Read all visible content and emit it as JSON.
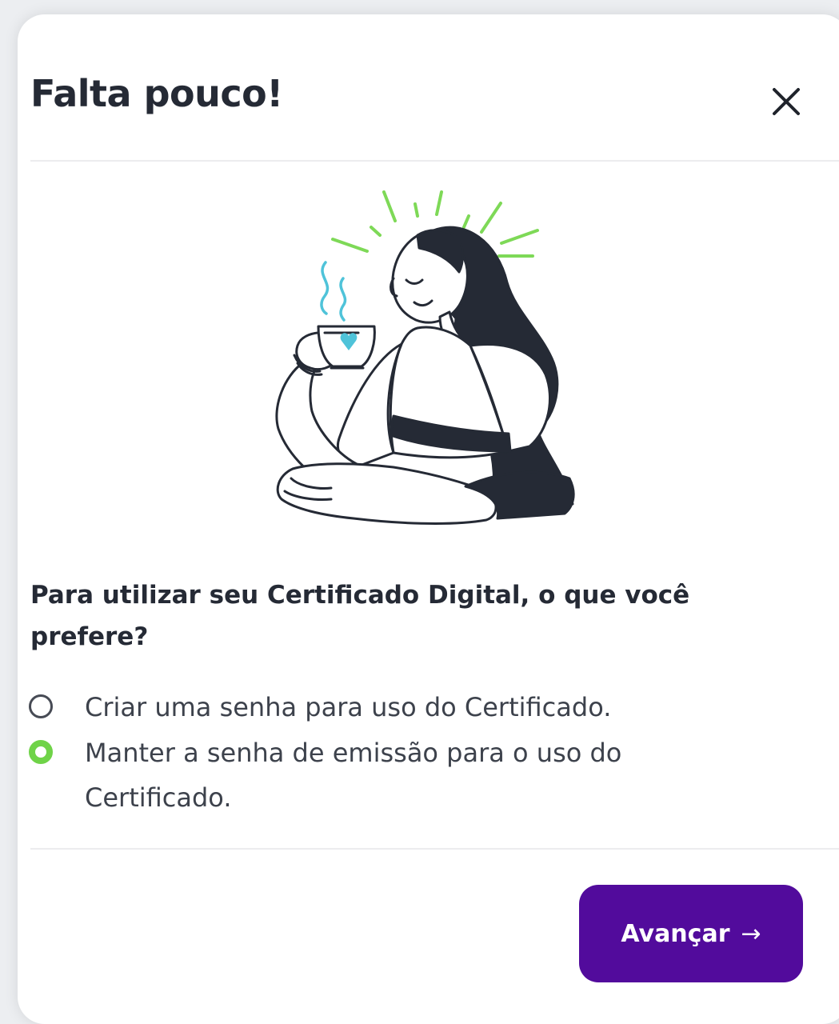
{
  "modal": {
    "title": "Falta pouco!",
    "close_icon": "close-icon",
    "question": "Para utilizar seu Certificado Digital, o que você prefere?",
    "options": [
      {
        "label": "Criar uma senha para uso do Certificado.",
        "selected": false
      },
      {
        "label": "Manter a senha de emissão para o uso do Certificado.",
        "selected": true
      }
    ],
    "next_button": {
      "label": "Avançar",
      "icon": "arrow-right-icon",
      "arrow": "→"
    },
    "illustration_icon": "woman-drinking-coffee-illustration"
  },
  "colors": {
    "primary": "#520b9c",
    "accent_green": "#6fd348",
    "cup_heart": "#4fc3d9",
    "text_dark": "#252a35"
  }
}
